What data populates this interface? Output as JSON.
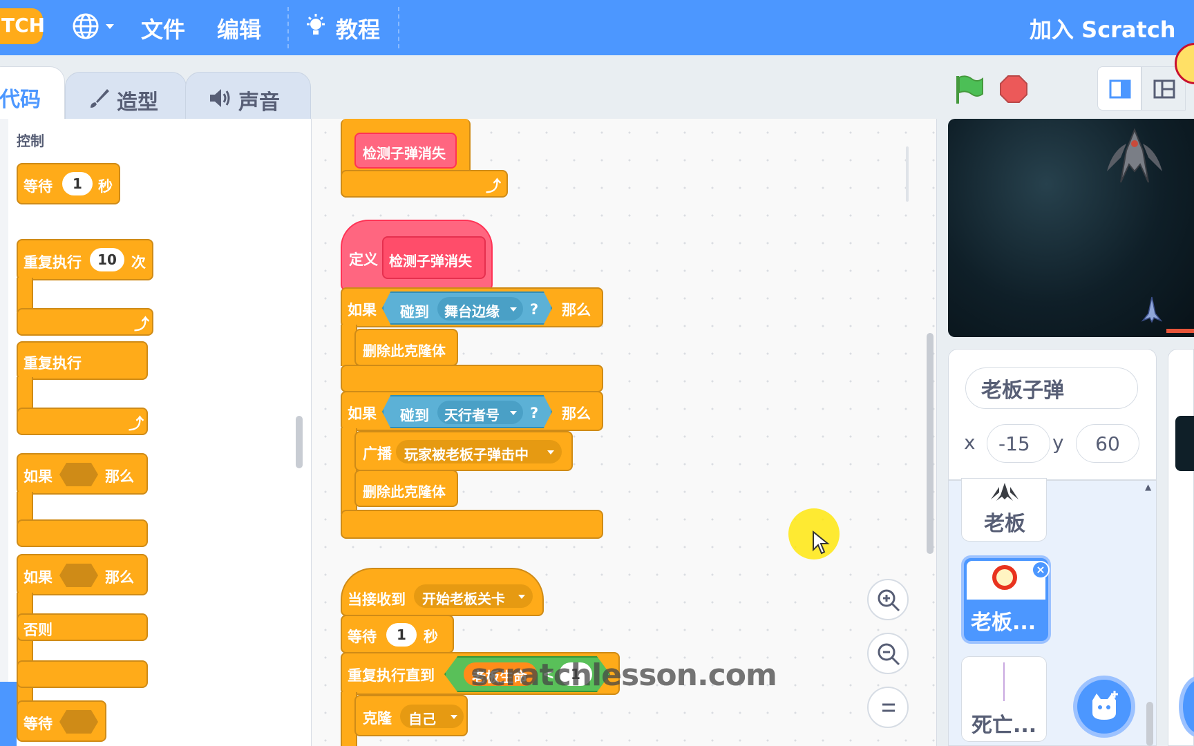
{
  "menu": {
    "logo_text": "TCH",
    "file": "文件",
    "edit": "编辑",
    "tutorial": "教程",
    "join": "加入 Scratch"
  },
  "tabs": {
    "code": "代码",
    "costumes": "造型",
    "sounds": "声音"
  },
  "palette": {
    "category": "控制",
    "wait": {
      "label": "等待",
      "value": "1",
      "unit": "秒"
    },
    "repeat": {
      "label": "重复执行",
      "value": "10",
      "unit": "次"
    },
    "forever": "重复执行",
    "if_then": {
      "if": "如果",
      "then": "那么"
    },
    "if_else": {
      "if": "如果",
      "then": "那么",
      "else": "否则"
    },
    "wait_until": "等待"
  },
  "script": {
    "call_block": "检测子弹消失",
    "define": {
      "label": "定义",
      "name": "检测子弹消失"
    },
    "if1": {
      "if": "如果",
      "touching": "碰到",
      "target": "舞台边缘",
      "q": "?",
      "then": "那么",
      "action": "删除此克隆体"
    },
    "if2": {
      "if": "如果",
      "touching": "碰到",
      "target": "天行者号",
      "q": "?",
      "then": "那么",
      "broadcast": "广播",
      "message": "玩家被老板子弹击中",
      "action": "删除此克隆体"
    },
    "hat": {
      "label": "当接收到",
      "message": "开始老板关卡"
    },
    "wait": {
      "label": "等待",
      "value": "1",
      "unit": "秒"
    },
    "repeat_until": {
      "label": "重复执行直到",
      "var": "老板生命",
      "op": "<",
      "value": "1"
    },
    "clone": {
      "label": "克隆",
      "target": "自己"
    }
  },
  "watermark": "scratchlesson.com",
  "sprite_info": {
    "name": "老板子弹",
    "x_label": "x",
    "x": "-15",
    "y_label": "y",
    "y": "60"
  },
  "sprites": [
    "老板",
    "老板...",
    "死亡..."
  ],
  "colors": {
    "menu": "#4c97ff",
    "control": "#ffab19",
    "sensing": "#5cb1d6",
    "custom": "#ff6680",
    "operators": "#59c059"
  }
}
